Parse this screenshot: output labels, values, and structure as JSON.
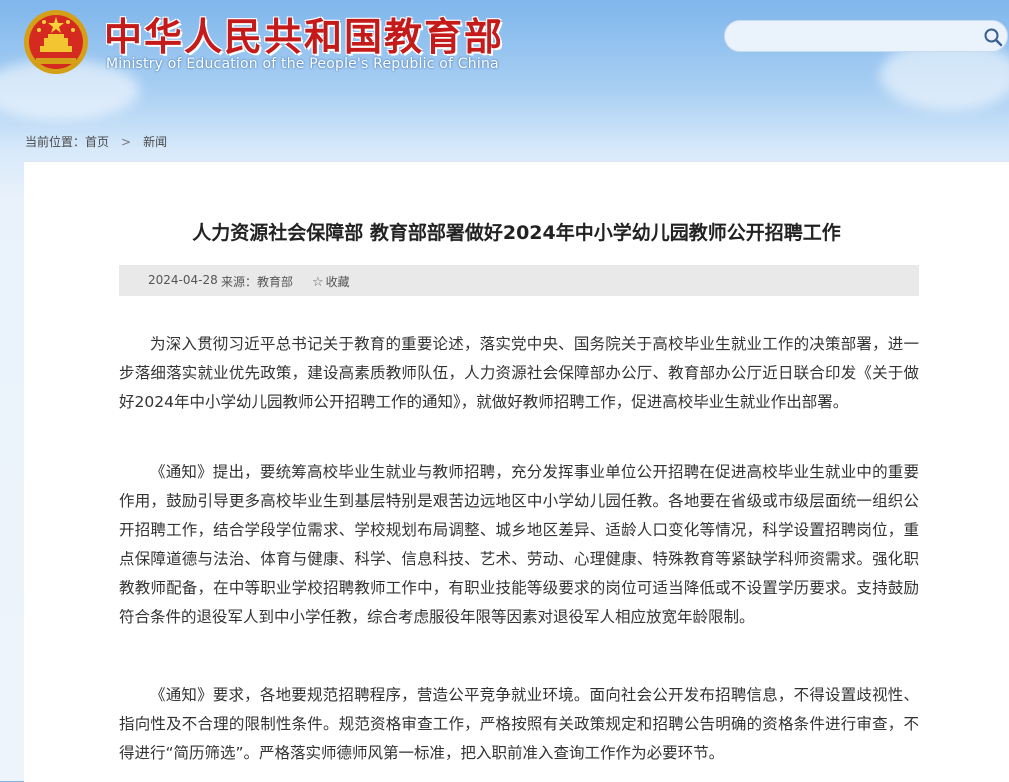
{
  "header": {
    "title": "中华人民共和国教育部",
    "subtitle": "Ministry of Education of the People's Republic of China",
    "emblem_icon": "national-emblem-icon"
  },
  "search": {
    "placeholder": "",
    "icon": "search-icon"
  },
  "breadcrumb": {
    "label": "当前位置：",
    "items": [
      "首页",
      "新闻"
    ],
    "separator": ">"
  },
  "article": {
    "title": "人力资源社会保障部 教育部部署做好2024年中小学幼儿园教师公开招聘工作",
    "date": "2024-04-28",
    "source": "来源：教育部",
    "favorite_label": "收藏",
    "favorite_icon": "star-icon",
    "paragraphs": [
      "为深入贯彻习近平总书记关于教育的重要论述，落实党中央、国务院关于高校毕业生就业工作的决策部署，进一步落细落实就业优先政策，建设高素质教师队伍，人力资源社会保障部办公厅、教育部办公厅近日联合印发《关于做好2024年中小学幼儿园教师公开招聘工作的通知》，就做好教师招聘工作，促进高校毕业生就业作出部署。",
      "《通知》提出，要统筹高校毕业生就业与教师招聘，充分发挥事业单位公开招聘在促进高校毕业生就业中的重要作用，鼓励引导更多高校毕业生到基层特别是艰苦边远地区中小学幼儿园任教。各地要在省级或市级层面统一组织公开招聘工作，结合学段学位需求、学校规划布局调整、城乡地区差异、适龄人口变化等情况，科学设置招聘岗位，重点保障道德与法治、体育与健康、科学、信息科技、艺术、劳动、心理健康、特殊教育等紧缺学科师资需求。强化职教教师配备，在中等职业学校招聘教师工作中，有职业技能等级要求的岗位可适当降低或不设置学历要求。支持鼓励符合条件的退役军人到中小学任教，综合考虑服役年限等因素对退役军人相应放宽年龄限制。",
      "《通知》要求，各地要规范招聘程序，营造公平竞争就业环境。面向社会公开发布招聘信息，不得设置歧视性、指向性及不合理的限制性条件。规范资格审查工作，严格按照有关政策规定和招聘公告明确的资格条件进行审查，不得进行“简历筛选”。严格落实师德师风第一标准，把入职前准入查询工作作为必要环节。"
    ]
  },
  "colors": {
    "title_red": "#c51a1a",
    "sky_blue": "#7fb6ec",
    "meta_bar": "#e9e9e9"
  }
}
